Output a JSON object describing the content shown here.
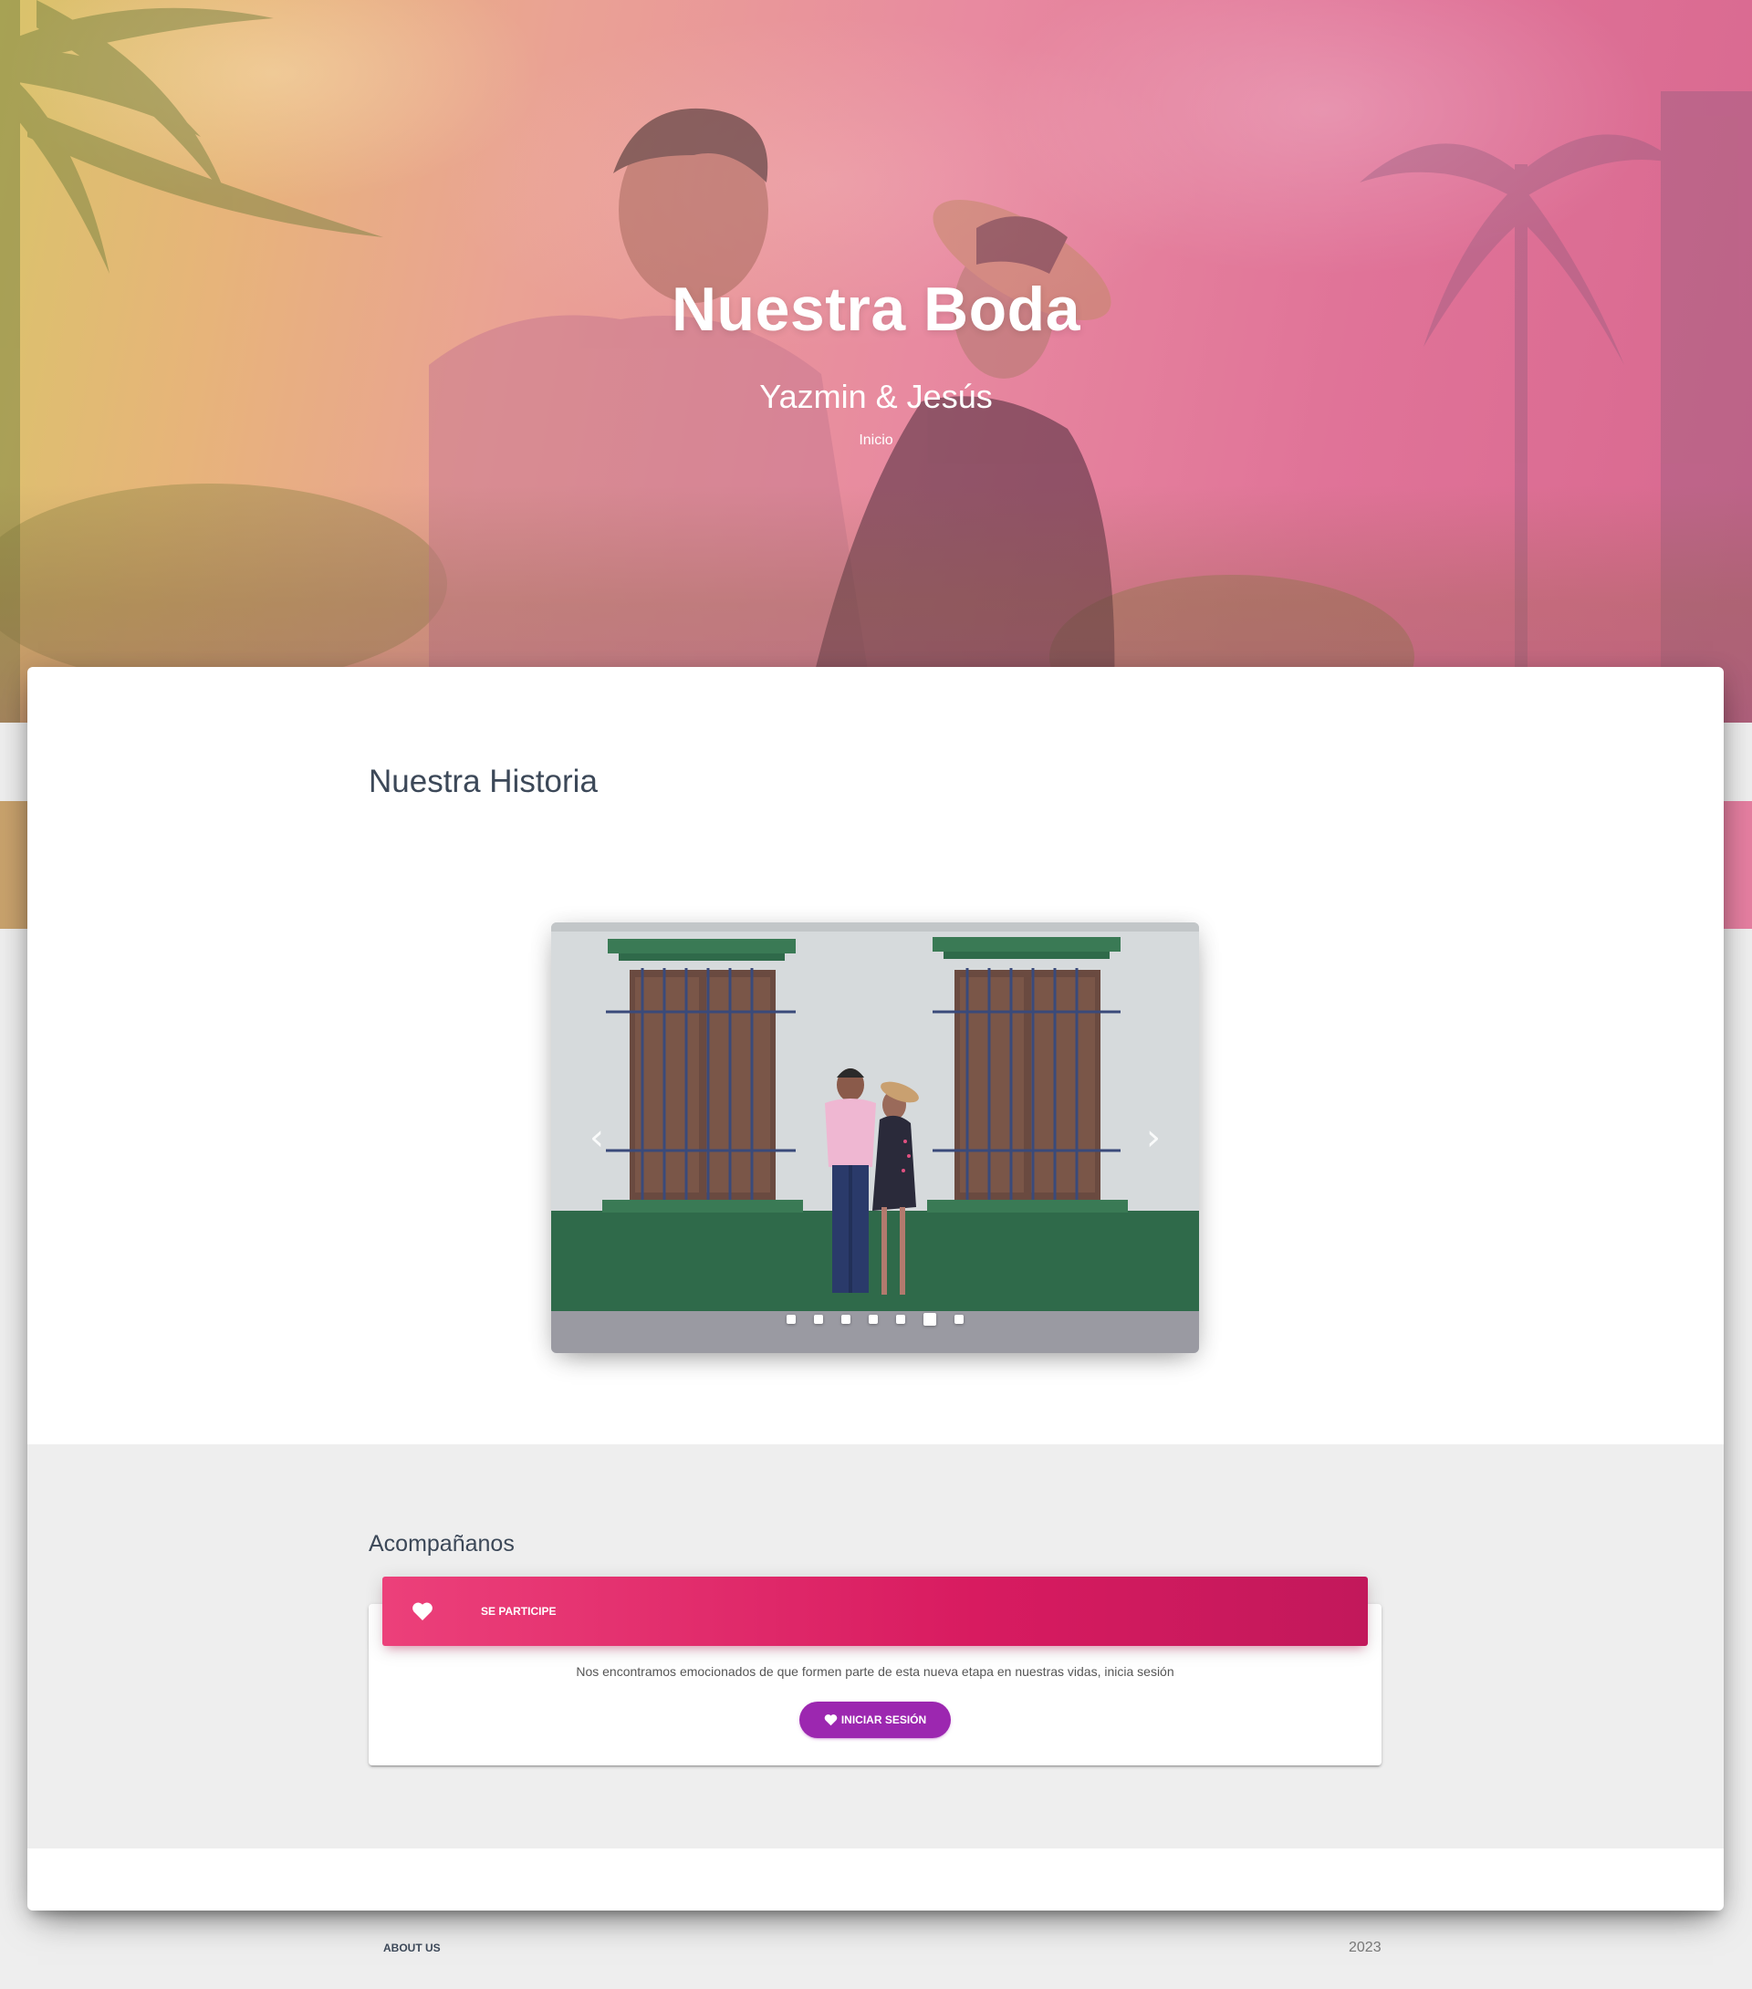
{
  "hero": {
    "title": "Nuestra Boda",
    "subtitle": "Yazmin & Jesús",
    "link_label": "Inicio"
  },
  "story": {
    "title": "Nuestra Historia",
    "carousel": {
      "prev_icon": "chevron-left-icon",
      "next_icon": "chevron-right-icon",
      "slide_count": 7,
      "active_index": 5
    }
  },
  "join": {
    "title": "Acompañanos",
    "header_icon": "heart-icon",
    "header_label": "SE PARTICIPE",
    "text": "Nos encontramos emocionados de que formen parte de esta nueva etapa en nuestras vidas, inicia sesión",
    "button_label": "INICIAR SESIÓN",
    "button_icon": "heart-icon"
  },
  "footer": {
    "link_label": "ABOUT US",
    "year": "2023"
  },
  "colors": {
    "header_gradient_start": "#ec407a",
    "header_gradient_end": "#c2185b",
    "button": "#9c27b0"
  }
}
